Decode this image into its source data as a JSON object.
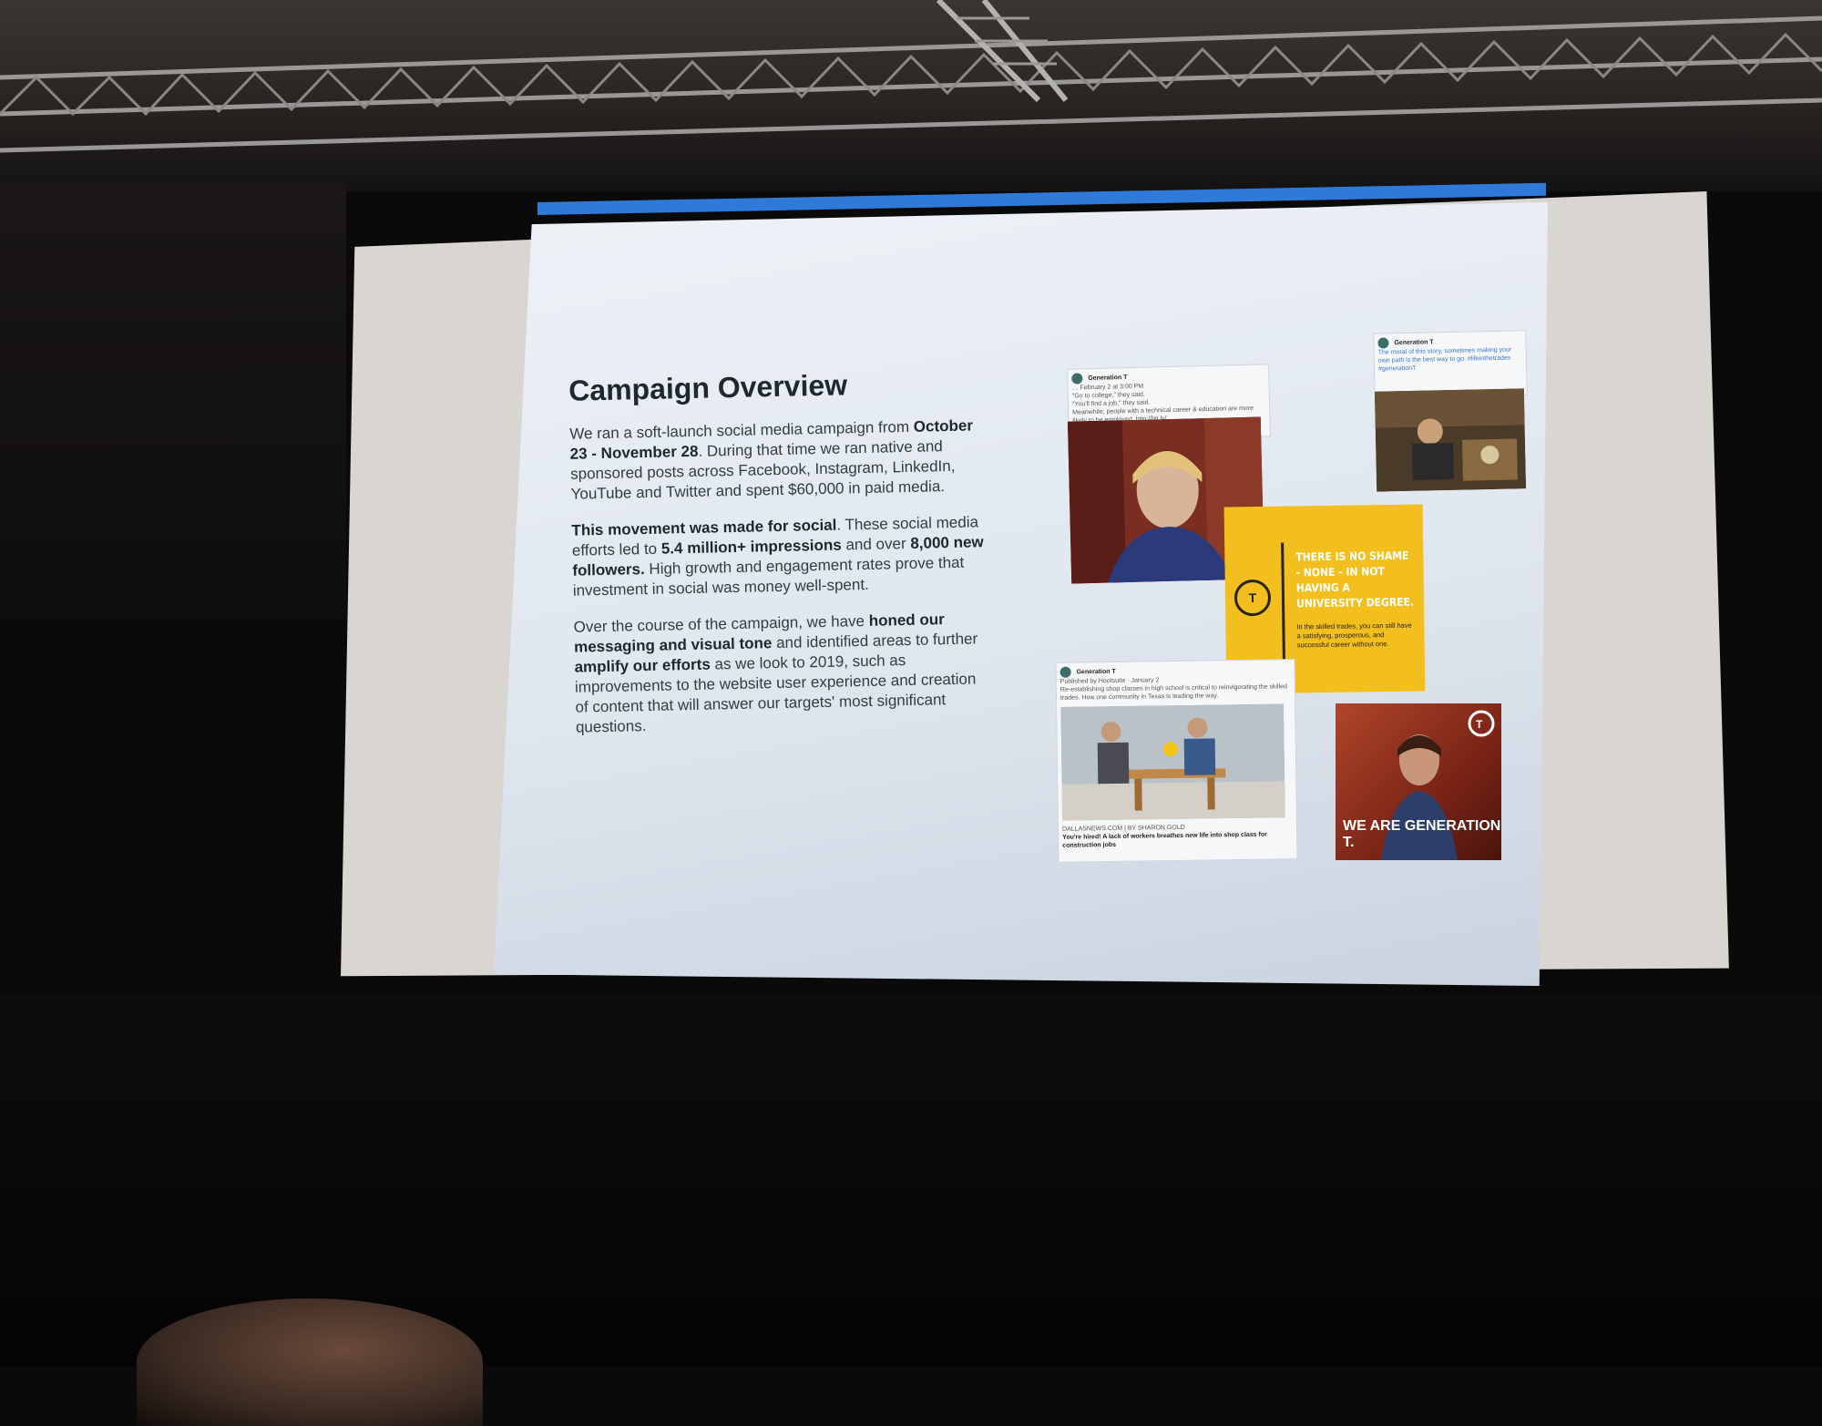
{
  "slide": {
    "title": "Campaign Overview",
    "paragraphs": [
      [
        {
          "t": "We ran a soft-launch social media campaign from ",
          "b": false
        },
        {
          "t": "October 23 -  November 28",
          "b": true
        },
        {
          "t": ". During that time we ran native and sponsored posts across Facebook, Instagram, LinkedIn, YouTube and Twitter and spent $60,000 in paid media.",
          "b": false
        }
      ],
      [
        {
          "t": "This movement was made for social",
          "b": true
        },
        {
          "t": ". These social media efforts led to ",
          "b": false
        },
        {
          "t": "5.4 million+ impressions",
          "b": true
        },
        {
          "t": " and over ",
          "b": false
        },
        {
          "t": "8,000 new followers.",
          "b": true
        },
        {
          "t": " High growth and engagement rates prove that investment in social was money well-spent.",
          "b": false
        }
      ],
      [
        {
          "t": "Over the course of the campaign, we have ",
          "b": false
        },
        {
          "t": "honed our messaging and visual tone",
          "b": true
        },
        {
          "t": " and identified areas to further ",
          "b": false
        },
        {
          "t": "amplify our efforts",
          "b": true
        },
        {
          "t": " as we look to 2019, such as improvements to the website user experience and creation of content that will answer our targets' most significant questions.",
          "b": false
        }
      ]
    ]
  },
  "collage": {
    "post1": {
      "author": "Generation T",
      "meta": "… February 2 at 3:00 PM",
      "line1": "\"Go to college,\" they said.",
      "line2": "\"You'll find a job,\" they said.",
      "line3": "Meanwhile, people with a technical career & education are more likely to be employed. http://bit.ly/..."
    },
    "post2": {
      "author": "Generation T",
      "body": "The moral of this story, sometimes making your own path is the best way to go. #lifeinthetrades #generationT"
    },
    "post3": {
      "author": "Generation T",
      "meta": "Published by Hootsuite · January 2",
      "line1": "Re-establishing shop classes in high school is critical to reinvigorating the skilled trades. How one community in Texas is leading the way.",
      "source": "DALLASNEWS.COM | BY SHARON GOLD",
      "headline": "You're hired! A lack of workers breathes new life into shop class for construction jobs"
    },
    "yellow_card": {
      "logo": "T",
      "headline": "THERE IS NO SHAME - NONE - IN NOT HAVING A UNIVERSITY DEGREE.",
      "sub": "In the skilled trades, you can still have a satisfying, prosperous, and successful career without one."
    },
    "red_card": {
      "text": "WE ARE GENERATION T."
    }
  },
  "colors": {
    "slide_bar": "#2f7ad9",
    "yellow": "#f3bf1e",
    "screen": "#d9d6d2"
  }
}
